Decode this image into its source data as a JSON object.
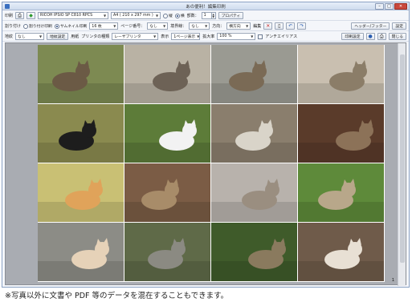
{
  "window": {
    "title": "あの便利！編集印刷",
    "close_glyph": "✕",
    "min_glyph": "–",
    "max_glyph": "□"
  },
  "toolbar1": {
    "print_label": "印刷",
    "printer": "RICOH IPSIO SP C810 RPCS",
    "paper": "A4 ( 210 x 297 mm )",
    "orientation_portrait": "縦",
    "orientation_landscape": "横",
    "copies_label": "部数：",
    "copies_value": "1",
    "properties_label": "プロパティ"
  },
  "toolbar2": {
    "layout_label": "割り付け",
    "layout_off": "割り付け印刷",
    "layout_thumb": "サムネイル印刷",
    "count": "16 枚",
    "page_no_label": "ページ番号：",
    "page_no_value": "なし",
    "border_label": "境界線：",
    "border_value": "なし",
    "direction_label": "方向：",
    "direction_value": "横方向",
    "edit_label": "編集",
    "header_footer_label": "ヘッダー/フッター",
    "settings_label": "設定"
  },
  "toolbar3": {
    "color_label": "地紋",
    "color_value": "なし",
    "color_settings_label": "地紋設定",
    "paper_label": "用紙",
    "paper_kind": "プリンタの種類",
    "paper_value": "レーザプリンタ",
    "view_label": "表示",
    "view_value": "1ページ表示",
    "zoom_label": "拡大率",
    "zoom_value": "100 %",
    "antialias_label": "アンチエイリアス",
    "print_settings_label": "印刷設定",
    "close_label": "閉じる"
  },
  "preview": {
    "page_number": "1"
  },
  "caption": "※写真以外に文書や PDF 等のデータを混在することもできます。",
  "photos": [
    {
      "name": "cat-photo-1",
      "bg": "#7d8a52",
      "fg": "#6b5a45"
    },
    {
      "name": "cat-photo-2",
      "bg": "#b9b2a4",
      "fg": "#6d6256"
    },
    {
      "name": "cat-photo-3",
      "bg": "#9a9a92",
      "fg": "#7a6a55"
    },
    {
      "name": "cat-photo-4",
      "bg": "#c9bfb0",
      "fg": "#8b7d68"
    },
    {
      "name": "cat-photo-5",
      "bg": "#8a8a4f",
      "fg": "#1d1d1d"
    },
    {
      "name": "cat-photo-6",
      "bg": "#5d7c39",
      "fg": "#f2f2f2"
    },
    {
      "name": "cat-photo-7",
      "bg": "#8a7e6d",
      "fg": "#d9d4c9"
    },
    {
      "name": "cat-photo-8",
      "bg": "#5a3b2a",
      "fg": "#8c7258"
    },
    {
      "name": "cat-photo-9",
      "bg": "#c9c074",
      "fg": "#e0a35a"
    },
    {
      "name": "cat-photo-10",
      "bg": "#7b5c45",
      "fg": "#a88c69"
    },
    {
      "name": "cat-photo-11",
      "bg": "#b8b2ac",
      "fg": "#9a8e80"
    },
    {
      "name": "cat-photo-12",
      "bg": "#5e8a3a",
      "fg": "#b8a78a"
    },
    {
      "name": "cat-photo-13",
      "bg": "#8c8c86",
      "fg": "#e6d2b8"
    },
    {
      "name": "cat-photo-14",
      "bg": "#5f6a48",
      "fg": "#8b8a82"
    },
    {
      "name": "cat-photo-15",
      "bg": "#3f5b2a",
      "fg": "#8a7a5e"
    },
    {
      "name": "cat-photo-16",
      "bg": "#6f5b4a",
      "fg": "#e8e0d4"
    }
  ]
}
